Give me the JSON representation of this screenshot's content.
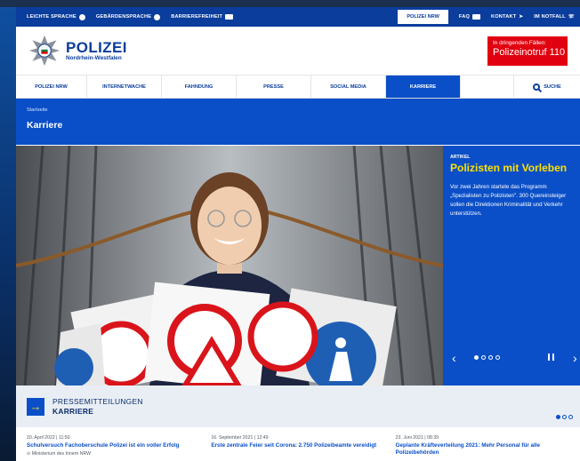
{
  "topbar": {
    "left": [
      "LEICHTE SPRACHE",
      "GEBÄRDENSPRACHE",
      "BARRIEREFREIHEIT"
    ],
    "pill": "POLIZEI NRW",
    "right": [
      "FAQ",
      "KONTAKT",
      "IM NOTFALL"
    ]
  },
  "brand": {
    "title": "POLIZEI",
    "subtitle": "Nordrhein-Westfalen"
  },
  "emergency": {
    "line1": "In dringenden Fällen:",
    "line2": "Polizeinotruf 110"
  },
  "nav": {
    "items": [
      "POLIZEI NRW",
      "INTERNETWACHE",
      "FAHNDUNG",
      "PRESSE",
      "SOCIAL MEDIA",
      "KARRIERE"
    ],
    "search": "SUCHE"
  },
  "band": {
    "breadcrumb": "Startseite",
    "title": "Karriere"
  },
  "article": {
    "kicker": "ARTIKEL",
    "title": "Polizisten mit Vorleben",
    "text": "Vor zwei Jahren startete das Programm „Spezialisten zu Polizisten\". 300 Quereinsteiger sollen die Direktionen Kriminalität und Verkehr unterstützen."
  },
  "press": {
    "line1": "PRESSEMITTEILUNGEN",
    "line2": "KARRIERE"
  },
  "news": [
    {
      "date": "20. April 2022 | 11:50",
      "headline": "Schulversuch Fachoberschule Polizei ist ein voller Erfolg",
      "source": "Ministerium des Innern NRW"
    },
    {
      "date": "16. September 2021 | 12:49",
      "headline": "Erste zentrale Feier seit Corona: 2.750 Polizeibeamte vereidigt",
      "source": ""
    },
    {
      "date": "23. Juni 2021 | 08:39",
      "headline": "Geplante Kräfteverteilung 2021: Mehr Personal für alle Polizeibehörden",
      "source": ""
    }
  ],
  "carousel": {
    "slide_count": 4,
    "active_index": 0
  },
  "colors": {
    "primary": "#0a4fc8",
    "dark": "#0a3d9c",
    "accent": "#ffe000",
    "emergency": "#e1000f"
  }
}
